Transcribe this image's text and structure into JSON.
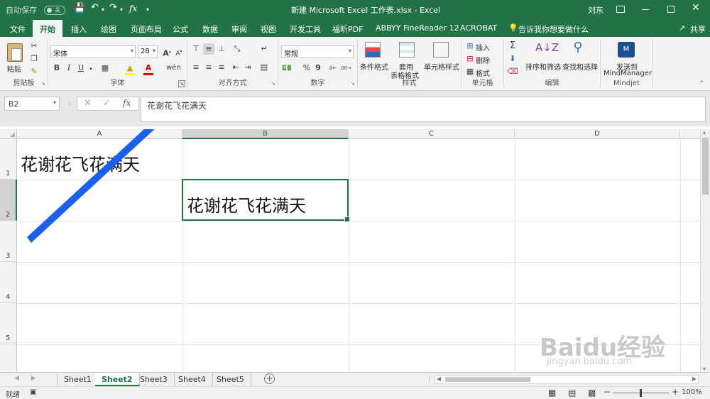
{
  "titlebar": {
    "autosave_label": "自动保存",
    "autosave_state": "关",
    "fx_symbol": "fx",
    "doc_title": "新建 Microsoft Excel 工作表.xlsx - Excel",
    "user": "刘东"
  },
  "tabs": [
    "文件",
    "开始",
    "插入",
    "绘图",
    "页面布局",
    "公式",
    "数据",
    "审阅",
    "视图",
    "开发工具",
    "福昕PDF",
    "ABBYY FineReader 12",
    "ACROBAT"
  ],
  "tell_me": "告诉我你想要做什么",
  "share": "共享",
  "ribbon": {
    "clipboard": {
      "paste_label": "粘贴",
      "group_label": "剪贴板"
    },
    "font": {
      "font_name": "宋体",
      "font_size": "28",
      "bold": "B",
      "italic": "I",
      "underline": "U",
      "group_label": "字体"
    },
    "alignment": {
      "group_label": "对齐方式"
    },
    "number": {
      "format": "常规",
      "percent": "%",
      "comma": "9",
      "group_label": "数字"
    },
    "styles": {
      "conditional": "条件格式",
      "table_format": "套用",
      "table_format2": "表格格式",
      "cell_styles": "单元格样式",
      "group_label": "样式"
    },
    "cells": {
      "insert": "插入",
      "delete": "删除",
      "format": "格式",
      "group_label": "单元格"
    },
    "editing": {
      "sort_filter": "排序和筛选",
      "find_select": "查找和选择",
      "group_label": "编辑"
    },
    "mindjet": {
      "send": "发送到",
      "app": "MindManager",
      "group_label": "Mindjet"
    }
  },
  "formula_bar": {
    "name_box": "B2",
    "formula": "花谢花飞花满天"
  },
  "columns": [
    "A",
    "B",
    "C",
    "D"
  ],
  "rows": [
    "1",
    "2",
    "3",
    "4",
    "5"
  ],
  "cells": {
    "A1": "花谢花飞花满天",
    "B2": "花谢花飞花满天"
  },
  "sheets": [
    "Sheet1",
    "Sheet2",
    "Sheet3",
    "Sheet4",
    "Sheet5"
  ],
  "active_sheet": "Sheet2",
  "status": {
    "ready": "就绪",
    "zoom": "100%"
  },
  "watermark": {
    "brand": "Baidu经验",
    "url": "jingyan.baidu.com"
  },
  "colors": {
    "excel_green": "#217346",
    "arrow_blue": "#1a5ff0"
  }
}
